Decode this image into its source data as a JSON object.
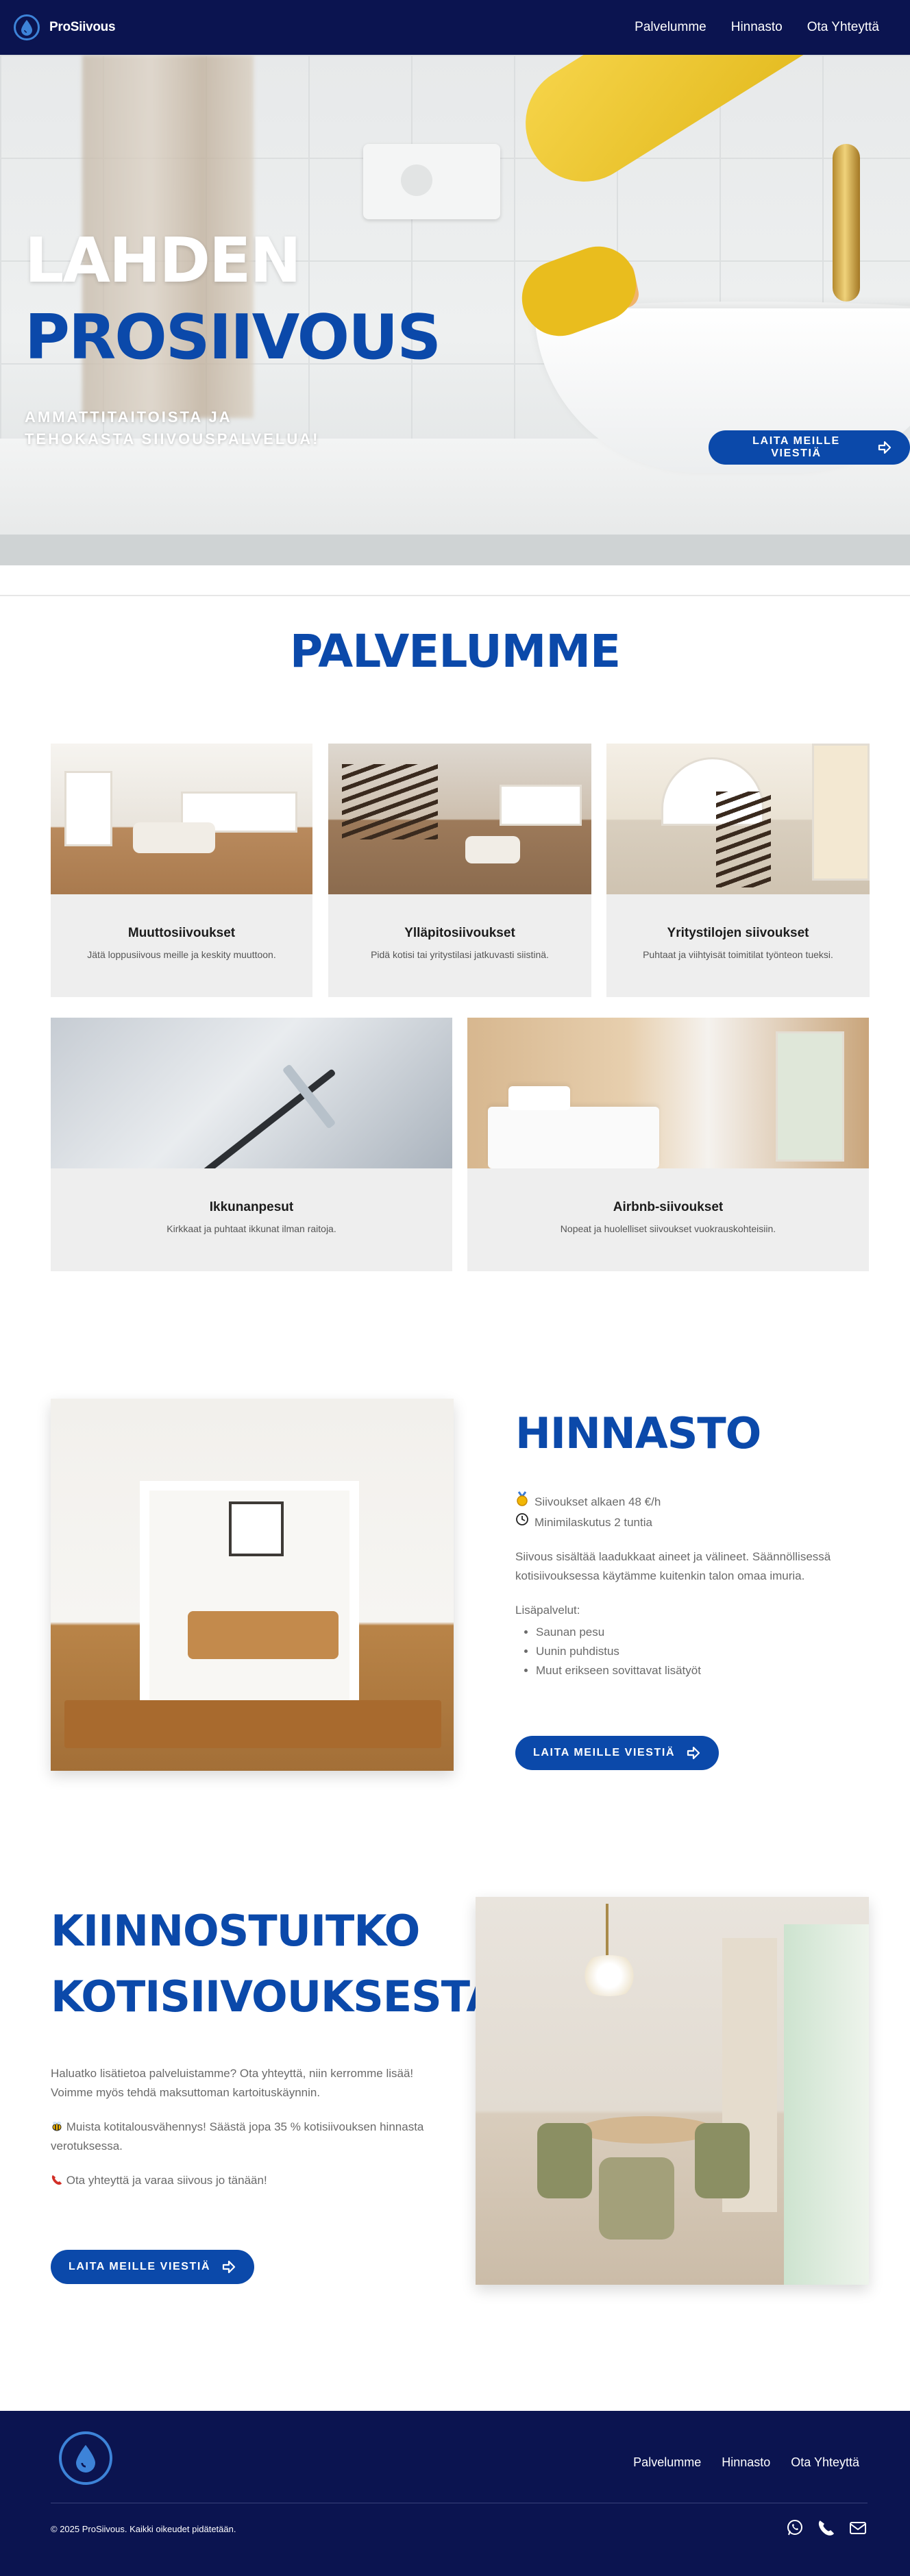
{
  "nav": {
    "brand": "ProSiivous",
    "links": [
      "Palvelumme",
      "Hinnasto",
      "Ota Yhteyttä"
    ]
  },
  "hero": {
    "title_line1": "LAHDEN",
    "title_line2": "PROSIIVOUS",
    "subtitle": "AMMATTITAITOISTA JA TEHOKASTA SIIVOUSPALVELUA!",
    "button": "LAITA MEILLE VIESTIÄ"
  },
  "services": {
    "title": "PALVELUMME",
    "cards": [
      {
        "title": "Muuttosiivoukset",
        "desc": "Jätä loppusiivous meille ja keskity muuttoon."
      },
      {
        "title": "Ylläpitosiivoukset",
        "desc": "Pidä kotisi tai yritystilasi jatkuvasti siistinä."
      },
      {
        "title": "Yritystilojen siivoukset",
        "desc": "Puhtaat ja viihtyisät toimitilat työnteon tueksi."
      },
      {
        "title": "Ikkunanpesut",
        "desc": "Kirkkaat ja puhtaat ikkunat ilman raitoja."
      },
      {
        "title": "Airbnb-siivoukset",
        "desc": "Nopeat ja huolelliset siivoukset vuokrauskohteisiin."
      }
    ]
  },
  "pricing": {
    "title": "HINNASTO",
    "price": "Siivoukset alkaen 48 €/h",
    "minimum": "Minimilaskutus 2 tuntia",
    "note": "Siivous sisältää laadukkaat aineet ja välineet. Säännöllisessä kotisiivouksessa käytämme kuitenkin talon omaa imuria.",
    "extras_label": "Lisäpalvelut:",
    "extras": [
      "Saunan pesu",
      "Uunin puhdistus",
      "Muut erikseen sovittavat lisätyöt"
    ],
    "button": "LAITA MEILLE VIESTIÄ"
  },
  "interest": {
    "title_line1": "KIINNOSTUITKO",
    "title_line2": "KOTISIIVOUKSESTA?",
    "p1": "Haluatko lisätietoa palveluistamme? Ota yhteyttä, niin kerromme lisää! Voimme myös tehdä maksuttoman kartoituskäynnin.",
    "p2": "Muista kotitalousvähennys! Säästä jopa 35 % kotisiivouksen hinnasta verotuksessa.",
    "p3": "Ota yhteyttä ja varaa siivous jo tänään!",
    "button": "LAITA MEILLE VIESTIÄ"
  },
  "footer": {
    "links": [
      "Palvelumme",
      "Hinnasto",
      "Ota Yhteyttä"
    ],
    "copyright": "© 2025 ProSiivous. Kaikki oikeudet pidätetään."
  },
  "icons": {
    "logo": "water-drop-icon",
    "arrow": "arrow-right-icon",
    "medal": "medal-icon",
    "clock": "clock-icon",
    "bee": "bee-icon",
    "phone": "phone-icon",
    "whatsapp": "whatsapp-icon",
    "mail": "mail-icon"
  },
  "colors": {
    "navy": "#0b1450",
    "brand_blue": "#0b49aa",
    "logo_blue": "#3d83d8",
    "card_bg": "#eeeeee"
  }
}
